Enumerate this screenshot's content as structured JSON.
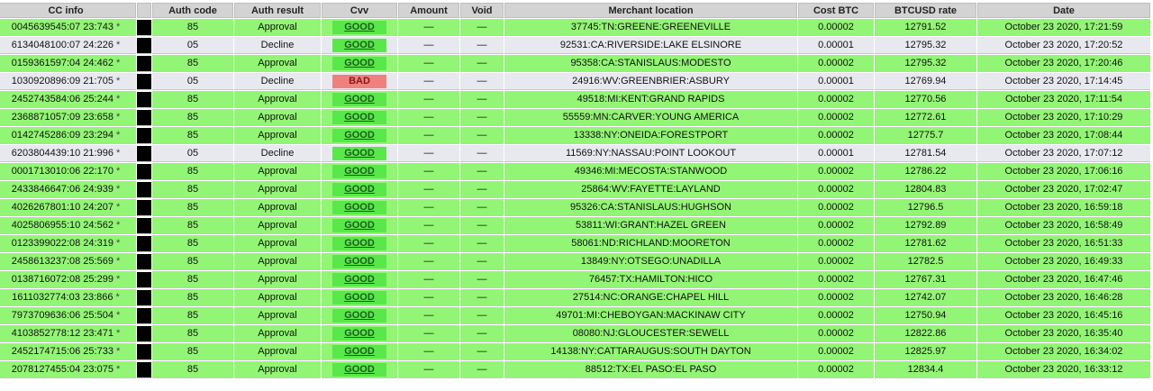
{
  "headers": {
    "cc_info": "CC info",
    "auth_code": "Auth code",
    "auth_result": "Auth result",
    "cvv": "Cvv",
    "amount": "Amount",
    "void": "Void",
    "merchant_location": "Merchant location",
    "cost_btc": "Cost BTC",
    "btcusd_rate": "BTCUSD rate",
    "date": "Date"
  },
  "star": "*",
  "colors": {
    "approved_row": "#93f575",
    "declined_row": "#e8e9ee",
    "good_badge": "#58e84a",
    "bad_badge": "#f08080"
  },
  "rows": [
    {
      "cc": "0045639545:07 23:743",
      "auth_code": "85",
      "result": "Approval",
      "cvv": "GOOD",
      "amount": "—",
      "void": "—",
      "location": "37745:TN:GREENE:GREENEVILLE",
      "cost": "0.00002",
      "rate": "12791.52",
      "date": "October 23 2020, 17:21:59"
    },
    {
      "cc": "6134048100:07 24:226",
      "auth_code": "05",
      "result": "Decline",
      "cvv": "GOOD",
      "amount": "—",
      "void": "—",
      "location": "92531:CA:RIVERSIDE:LAKE ELSINORE",
      "cost": "0.00001",
      "rate": "12795.32",
      "date": "October 23 2020, 17:20:52"
    },
    {
      "cc": "0159361597:04 24:462",
      "auth_code": "85",
      "result": "Approval",
      "cvv": "GOOD",
      "amount": "—",
      "void": "—",
      "location": "95358:CA:STANISLAUS:MODESTO",
      "cost": "0.00002",
      "rate": "12795.32",
      "date": "October 23 2020, 17:20:46"
    },
    {
      "cc": "1030920896:09 21:705",
      "auth_code": "05",
      "result": "Decline",
      "cvv": "BAD",
      "amount": "—",
      "void": "—",
      "location": "24916:WV:GREENBRIER:ASBURY",
      "cost": "0.00001",
      "rate": "12769.94",
      "date": "October 23 2020, 17:14:45"
    },
    {
      "cc": "2452743584:06 25:244",
      "auth_code": "85",
      "result": "Approval",
      "cvv": "GOOD",
      "amount": "—",
      "void": "—",
      "location": "49518:MI:KENT:GRAND RAPIDS",
      "cost": "0.00002",
      "rate": "12770.56",
      "date": "October 23 2020, 17:11:54"
    },
    {
      "cc": "2368871057:09 23:658",
      "auth_code": "85",
      "result": "Approval",
      "cvv": "GOOD",
      "amount": "—",
      "void": "—",
      "location": "55559:MN:CARVER:YOUNG AMERICA",
      "cost": "0.00002",
      "rate": "12772.61",
      "date": "October 23 2020, 17:10:29"
    },
    {
      "cc": "0142745286:09 23:294",
      "auth_code": "85",
      "result": "Approval",
      "cvv": "GOOD",
      "amount": "—",
      "void": "—",
      "location": "13338:NY:ONEIDA:FORESTPORT",
      "cost": "0.00002",
      "rate": "12775.7",
      "date": "October 23 2020, 17:08:44"
    },
    {
      "cc": "6203804439:10 21:996",
      "auth_code": "05",
      "result": "Decline",
      "cvv": "GOOD",
      "amount": "—",
      "void": "—",
      "location": "11569:NY:NASSAU:POINT LOOKOUT",
      "cost": "0.00001",
      "rate": "12781.54",
      "date": "October 23 2020, 17:07:12"
    },
    {
      "cc": "0001713010:06 22:170",
      "auth_code": "85",
      "result": "Approval",
      "cvv": "GOOD",
      "amount": "—",
      "void": "—",
      "location": "49346:MI:MECOSTA:STANWOOD",
      "cost": "0.00002",
      "rate": "12786.22",
      "date": "October 23 2020, 17:06:16"
    },
    {
      "cc": "2433846647:06 24:939",
      "auth_code": "85",
      "result": "Approval",
      "cvv": "GOOD",
      "amount": "—",
      "void": "—",
      "location": "25864:WV:FAYETTE:LAYLAND",
      "cost": "0.00002",
      "rate": "12804.83",
      "date": "October 23 2020, 17:02:47"
    },
    {
      "cc": "4026267801:10 24:207",
      "auth_code": "85",
      "result": "Approval",
      "cvv": "GOOD",
      "amount": "—",
      "void": "—",
      "location": "95326:CA:STANISLAUS:HUGHSON",
      "cost": "0.00002",
      "rate": "12796.5",
      "date": "October 23 2020, 16:59:18"
    },
    {
      "cc": "4025806955:10 24:562",
      "auth_code": "85",
      "result": "Approval",
      "cvv": "GOOD",
      "amount": "—",
      "void": "—",
      "location": "53811:WI:GRANT:HAZEL GREEN",
      "cost": "0.00002",
      "rate": "12792.89",
      "date": "October 23 2020, 16:58:49"
    },
    {
      "cc": "0123399022:08 24:319",
      "auth_code": "85",
      "result": "Approval",
      "cvv": "GOOD",
      "amount": "—",
      "void": "—",
      "location": "58061:ND:RICHLAND:MOORETON",
      "cost": "0.00002",
      "rate": "12781.62",
      "date": "October 23 2020, 16:51:33"
    },
    {
      "cc": "2458613237:08 25:569",
      "auth_code": "85",
      "result": "Approval",
      "cvv": "GOOD",
      "amount": "—",
      "void": "—",
      "location": "13849:NY:OTSEGO:UNADILLA",
      "cost": "0.00002",
      "rate": "12782.5",
      "date": "October 23 2020, 16:49:33"
    },
    {
      "cc": "0138716072:08 25:299",
      "auth_code": "85",
      "result": "Approval",
      "cvv": "GOOD",
      "amount": "—",
      "void": "—",
      "location": "76457:TX:HAMILTON:HICO",
      "cost": "0.00002",
      "rate": "12767.31",
      "date": "October 23 2020, 16:47:46"
    },
    {
      "cc": "1611032774:03 23:866",
      "auth_code": "85",
      "result": "Approval",
      "cvv": "GOOD",
      "amount": "—",
      "void": "—",
      "location": "27514:NC:ORANGE:CHAPEL HILL",
      "cost": "0.00002",
      "rate": "12742.07",
      "date": "October 23 2020, 16:46:28"
    },
    {
      "cc": "7973709636:06 25:504",
      "auth_code": "85",
      "result": "Approval",
      "cvv": "GOOD",
      "amount": "—",
      "void": "—",
      "location": "49701:MI:CHEBOYGAN:MACKINAW CITY",
      "cost": "0.00002",
      "rate": "12750.94",
      "date": "October 23 2020, 16:45:16"
    },
    {
      "cc": "4103852778:12 23:471",
      "auth_code": "85",
      "result": "Approval",
      "cvv": "GOOD",
      "amount": "—",
      "void": "—",
      "location": "08080:NJ:GLOUCESTER:SEWELL",
      "cost": "0.00002",
      "rate": "12822.86",
      "date": "October 23 2020, 16:35:40"
    },
    {
      "cc": "2452174715:06 25:733",
      "auth_code": "85",
      "result": "Approval",
      "cvv": "GOOD",
      "amount": "—",
      "void": "—",
      "location": "14138:NY:CATTARAUGUS:SOUTH DAYTON",
      "cost": "0.00002",
      "rate": "12825.97",
      "date": "October 23 2020, 16:34:02"
    },
    {
      "cc": "2078127455:04 23:075",
      "auth_code": "85",
      "result": "Approval",
      "cvv": "GOOD",
      "amount": "—",
      "void": "—",
      "location": "88512:TX:EL PASO:EL PASO",
      "cost": "0.00002",
      "rate": "12834.4",
      "date": "October 23 2020, 16:33:12"
    }
  ]
}
